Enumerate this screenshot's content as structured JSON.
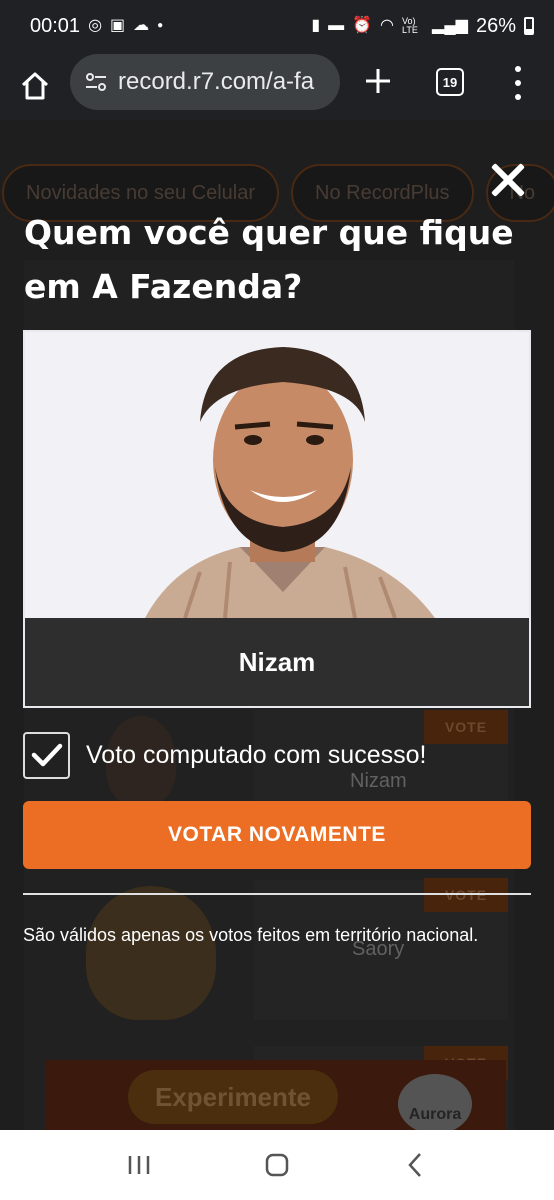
{
  "status_bar": {
    "time": "00:01",
    "battery": "26%",
    "network_label": "Vo) LTE"
  },
  "browser": {
    "url": "record.r7.com/a-fa",
    "tab_count": "19"
  },
  "background_page": {
    "chips": [
      "Novidades no seu Celular",
      "No RecordPlus",
      "No"
    ],
    "vote_label": "VOTE",
    "names": [
      "Nizam",
      "Saory"
    ],
    "ad_button": "Experimente",
    "ad_logo": "Aurora"
  },
  "modal": {
    "title": "Quem você quer que fique em A Fazenda?",
    "candidate_name": "Nizam",
    "success_message": "Voto computado com sucesso!",
    "vote_again_label": "VOTAR NOVAMENTE",
    "disclaimer": "São válidos apenas os votos feitos em território nacional."
  },
  "colors": {
    "accent": "#ec6e24",
    "overlay": "#262626",
    "card_bar": "#2e2e2e"
  }
}
